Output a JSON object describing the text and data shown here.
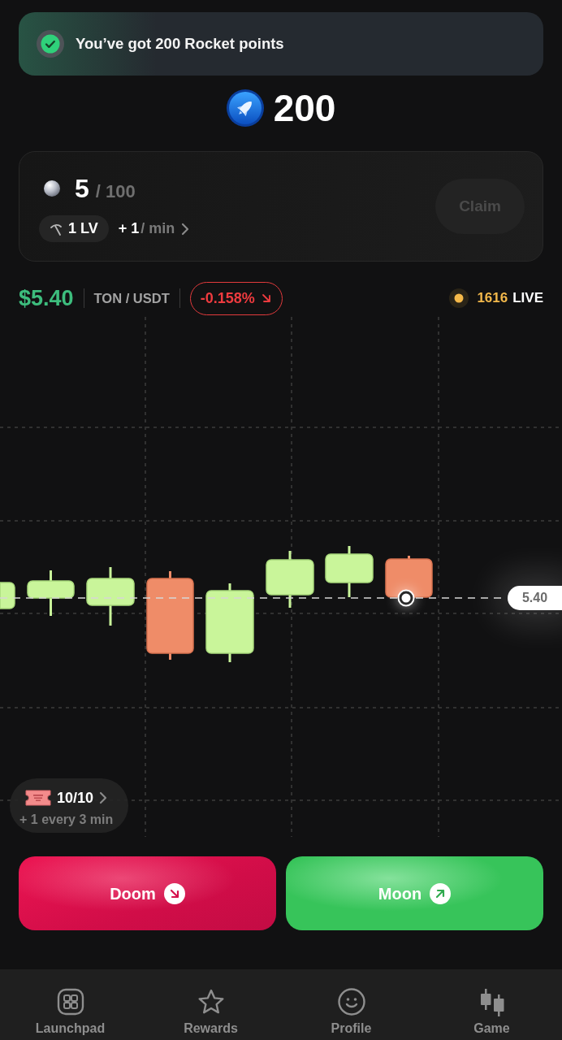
{
  "toast": {
    "text": "You’ve got 200 Rocket points"
  },
  "balance": {
    "amount": "200"
  },
  "mining": {
    "mined": "5",
    "capacity": "/ 100",
    "tier": "1 LV",
    "rate": "+ 1",
    "rate_unit": "/ min",
    "claim": {
      "label": "Claim",
      "disabled": true
    }
  },
  "ticker": {
    "price": "$5.40",
    "pair": "TON / USDT",
    "change": "-0.158%",
    "falling": true,
    "online_count": "1616",
    "live_label": "LIVE"
  },
  "chart": {
    "price_label": "5.40"
  },
  "tickets": {
    "count": "10/10",
    "refill": "+ 1 every 3 min"
  },
  "actions": [
    {
      "label": "Doom",
      "kind": "down"
    },
    {
      "label": "Moon",
      "kind": "up"
    }
  ],
  "nav": [
    {
      "label": "Launchpad",
      "kind": "grid"
    },
    {
      "label": "Rewards",
      "kind": "star"
    },
    {
      "label": "Profile",
      "kind": "smile"
    },
    {
      "label": "Game",
      "kind": "candles"
    }
  ]
}
